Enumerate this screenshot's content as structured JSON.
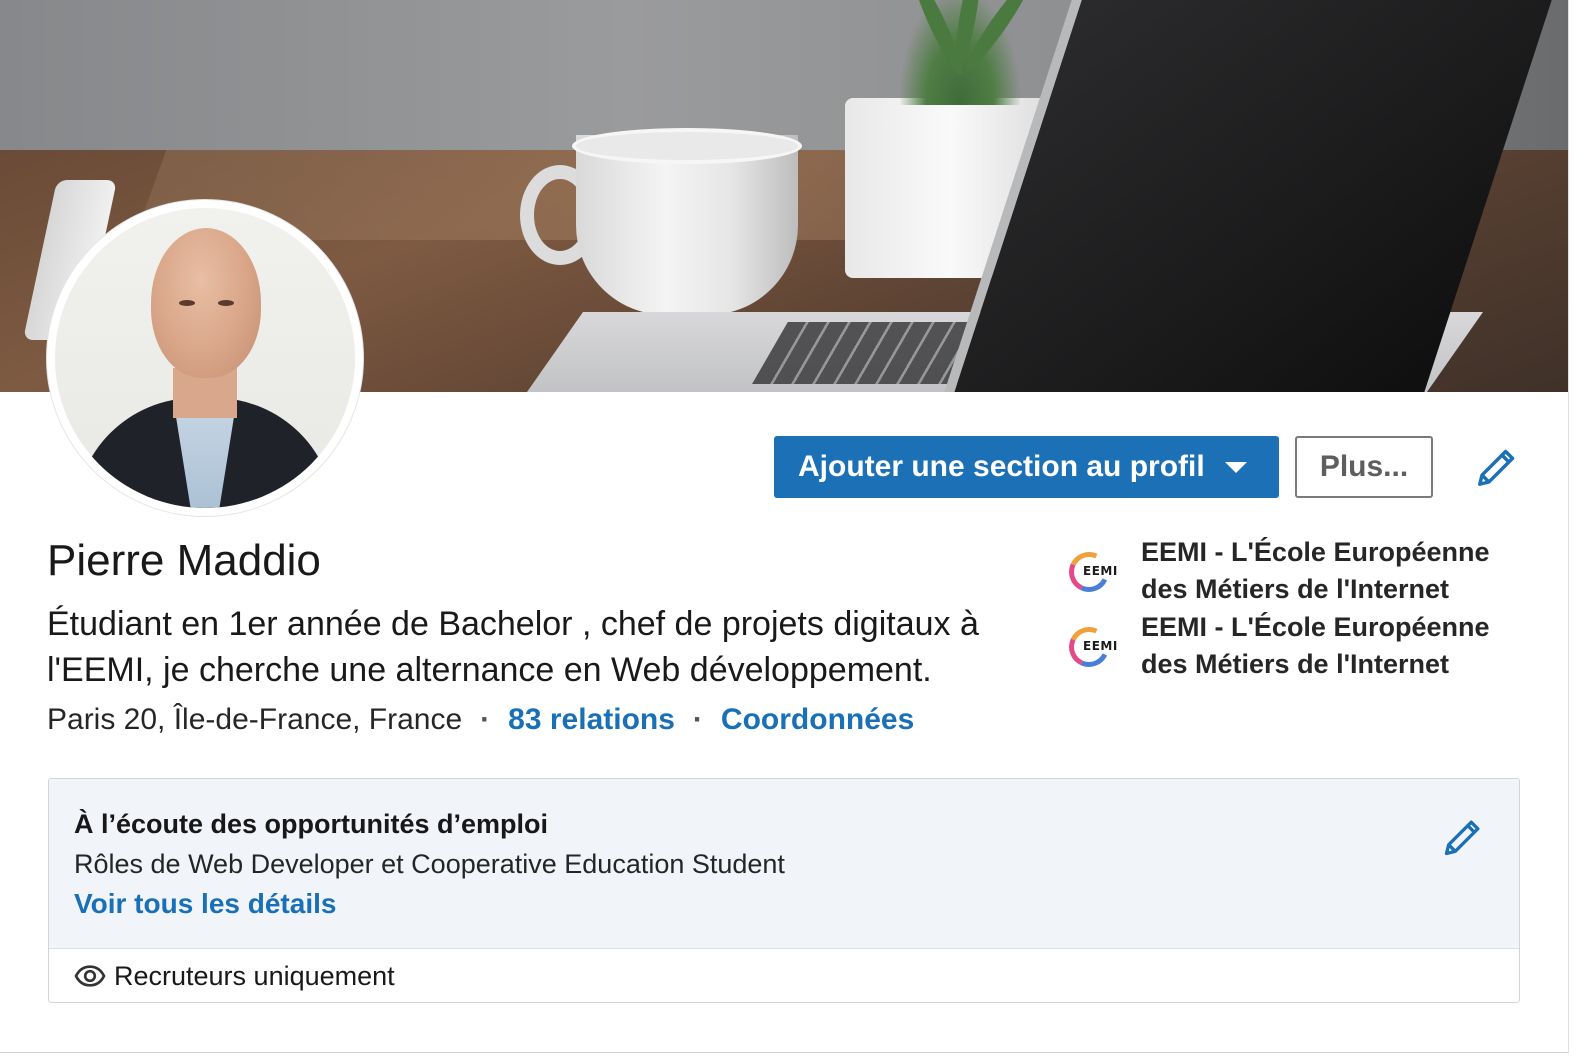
{
  "profile": {
    "name": "Pierre Maddio",
    "headline": "Étudiant en 1er année de Bachelor , chef de projets digitaux à l'EEMI, je cherche une alternance en Web développement.",
    "location": "Paris 20, Île-de-France, France",
    "separator": "·",
    "relations": "83 relations",
    "contact": "Coordonnées"
  },
  "actions": {
    "add_section": "Ajouter une section au profil",
    "more": "Plus...",
    "edit_icon": "pencil-icon"
  },
  "education": [
    {
      "name": "EEMI - L'École Européenne des Métiers de l'Internet",
      "logo_text": "EEMI"
    },
    {
      "name": "EEMI - L'École Européenne des Métiers de l'Internet",
      "logo_text": "EEMI"
    }
  ],
  "open_to_work": {
    "title": "À l’écoute des opportunités d’emploi",
    "roles": "Rôles de Web Developer et Cooperative Education Student",
    "details_link": "Voir tous les détails",
    "visibility": "Recruteurs uniquement",
    "visibility_icon": "eye-icon"
  },
  "colors": {
    "primary": "#1c70b6",
    "link": "#1a70b6",
    "panel_bg": "#f1f4f8"
  }
}
